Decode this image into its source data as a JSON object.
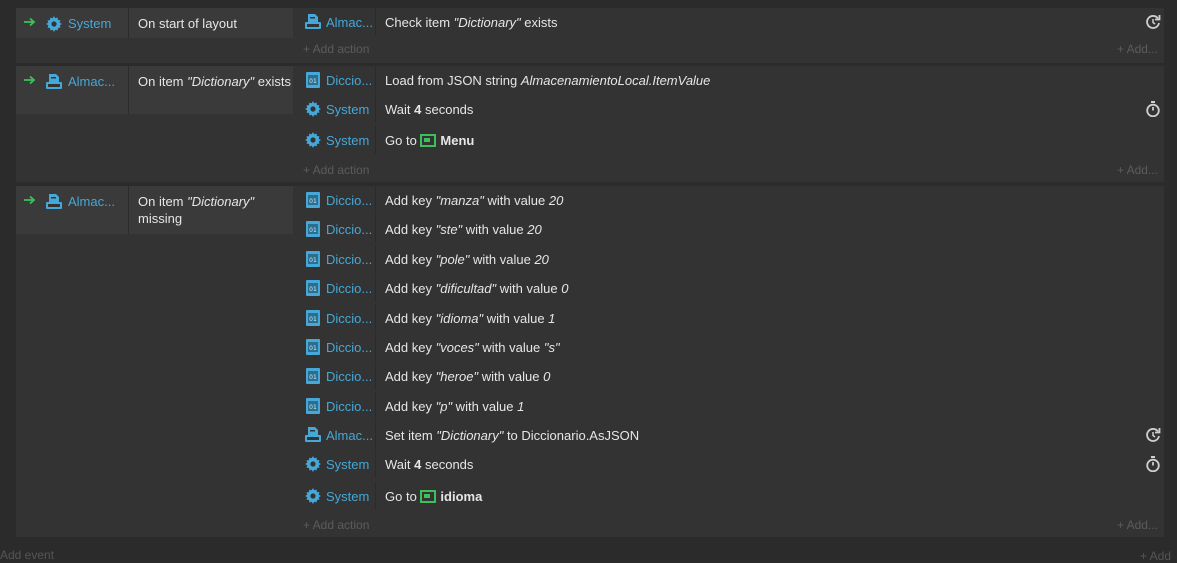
{
  "add_action_label": "+ Add action",
  "add_right_label": "+ Add...",
  "add_event_label": "Add event",
  "add_bottom_right": "+ Add",
  "events": [
    {
      "cond_obj": "System",
      "cond_text_parts": [
        {
          "t": "On start of layout",
          "i": false
        }
      ],
      "actions": [
        {
          "obj": "Almac...",
          "icon": "storage-icon",
          "parts": [
            {
              "t": "Check item ",
              "i": false
            },
            {
              "t": "\"Dictionary\"",
              "i": true
            },
            {
              "t": " exists",
              "i": false
            }
          ],
          "right": "restart-icon"
        }
      ]
    },
    {
      "cond_obj": "Almac...",
      "cond_text_parts": [
        {
          "t": "On item ",
          "i": false
        },
        {
          "t": "\"Dictionary\"",
          "i": true
        },
        {
          "t": " exists",
          "i": false
        }
      ],
      "actions": [
        {
          "obj": "Diccio...",
          "icon": "dictionary-icon",
          "parts": [
            {
              "t": "Load from JSON string ",
              "i": false
            },
            {
              "t": "AlmacenamientoLocal.ItemValue",
              "i": true
            }
          ]
        },
        {
          "obj": "System",
          "icon": "gear-icon",
          "parts": [
            {
              "t": "Wait ",
              "i": false
            },
            {
              "t": "4",
              "b": true
            },
            {
              "t": " seconds",
              "i": false
            }
          ],
          "right": "timer-icon"
        },
        {
          "obj": "System",
          "icon": "gear-icon",
          "goto": "Menu"
        }
      ]
    },
    {
      "cond_obj": "Almac...",
      "cond_text_parts": [
        {
          "t": "On item ",
          "i": false
        },
        {
          "t": "\"Dictionary\"",
          "i": true
        },
        {
          "t": " missing",
          "i": false
        }
      ],
      "actions": [
        {
          "obj": "Diccio...",
          "icon": "dictionary-icon",
          "parts": [
            {
              "t": "Add key ",
              "i": false
            },
            {
              "t": "\"manza\"",
              "i": true
            },
            {
              "t": " with value ",
              "i": false
            },
            {
              "t": "20",
              "i": true
            }
          ]
        },
        {
          "obj": "Diccio...",
          "icon": "dictionary-icon",
          "parts": [
            {
              "t": "Add key ",
              "i": false
            },
            {
              "t": "\"ste\"",
              "i": true
            },
            {
              "t": " with value ",
              "i": false
            },
            {
              "t": "20",
              "i": true
            }
          ]
        },
        {
          "obj": "Diccio...",
          "icon": "dictionary-icon",
          "parts": [
            {
              "t": "Add key ",
              "i": false
            },
            {
              "t": "\"pole\"",
              "i": true
            },
            {
              "t": " with value ",
              "i": false
            },
            {
              "t": "20",
              "i": true
            }
          ]
        },
        {
          "obj": "Diccio...",
          "icon": "dictionary-icon",
          "parts": [
            {
              "t": "Add key ",
              "i": false
            },
            {
              "t": "\"dificultad\"",
              "i": true
            },
            {
              "t": " with value ",
              "i": false
            },
            {
              "t": "0",
              "i": true
            }
          ]
        },
        {
          "obj": "Diccio...",
          "icon": "dictionary-icon",
          "parts": [
            {
              "t": "Add key ",
              "i": false
            },
            {
              "t": "\"idioma\"",
              "i": true
            },
            {
              "t": " with value ",
              "i": false
            },
            {
              "t": "1",
              "i": true
            }
          ]
        },
        {
          "obj": "Diccio...",
          "icon": "dictionary-icon",
          "parts": [
            {
              "t": "Add key ",
              "i": false
            },
            {
              "t": "\"voces\"",
              "i": true
            },
            {
              "t": " with value ",
              "i": false
            },
            {
              "t": "\"s\"",
              "i": true
            }
          ]
        },
        {
          "obj": "Diccio...",
          "icon": "dictionary-icon",
          "parts": [
            {
              "t": "Add key ",
              "i": false
            },
            {
              "t": "\"heroe\"",
              "i": true
            },
            {
              "t": " with value ",
              "i": false
            },
            {
              "t": "0",
              "i": true
            }
          ]
        },
        {
          "obj": "Diccio...",
          "icon": "dictionary-icon",
          "parts": [
            {
              "t": "Add key ",
              "i": false
            },
            {
              "t": "\"p\"",
              "i": true
            },
            {
              "t": " with value ",
              "i": false
            },
            {
              "t": "1",
              "i": true
            }
          ]
        },
        {
          "obj": "Almac...",
          "icon": "storage-icon",
          "parts": [
            {
              "t": "Set item ",
              "i": false
            },
            {
              "t": "\"Dictionary\"",
              "i": true
            },
            {
              "t": " to Diccionario.AsJSON",
              "i": false
            }
          ],
          "right": "restart-icon"
        },
        {
          "obj": "System",
          "icon": "gear-icon",
          "parts": [
            {
              "t": "Wait ",
              "i": false
            },
            {
              "t": "4",
              "b": true
            },
            {
              "t": " seconds",
              "i": false
            }
          ],
          "right": "timer-icon"
        },
        {
          "obj": "System",
          "icon": "gear-icon",
          "goto": "idioma"
        }
      ]
    }
  ]
}
